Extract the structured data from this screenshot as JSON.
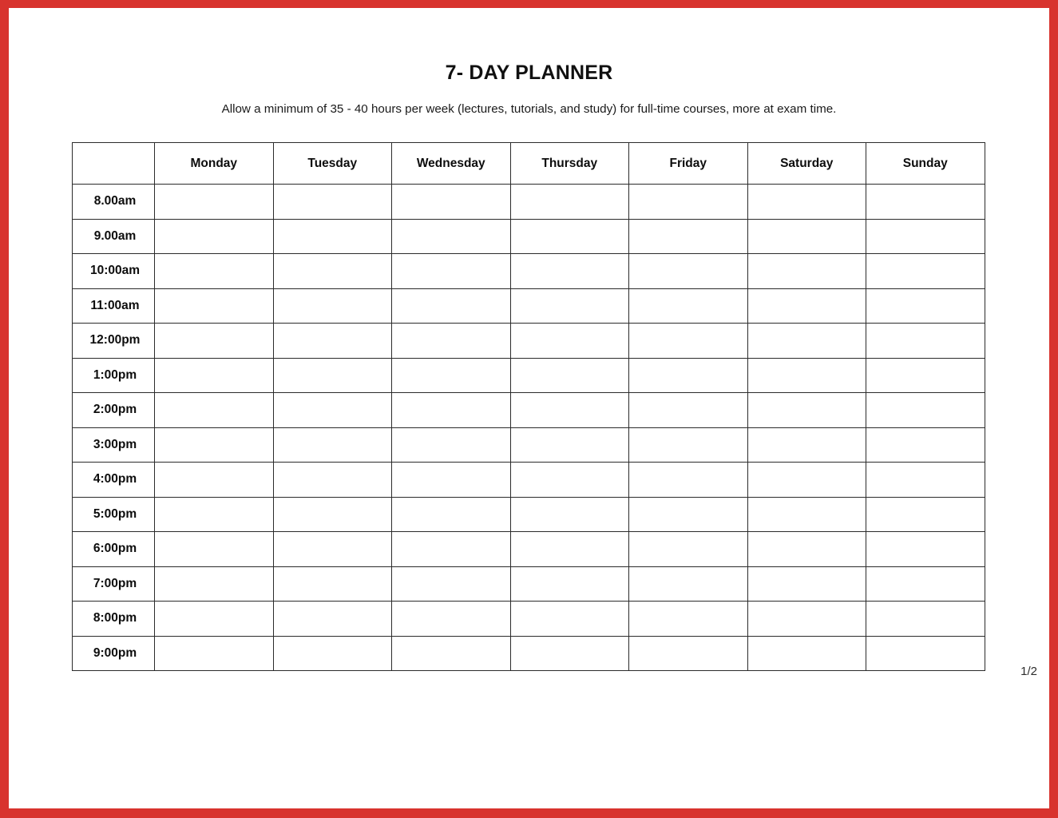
{
  "document": {
    "title": "7- DAY PLANNER",
    "subtitle": "Allow a minimum of 35 - 40 hours per week (lectures, tutorials, and study) for full-time courses, more at exam time.",
    "page_indicator": "1/2",
    "accent_color": "#d8332e",
    "border_color": "#d8332e",
    "grid_line_color": "#2b2b2b",
    "background_color": "#ffffff",
    "text_color": "#0d0d0d"
  },
  "table": {
    "corner_header": "",
    "day_headers": [
      "Monday",
      "Tuesday",
      "Wednesday",
      "Thursday",
      "Friday",
      "Saturday",
      "Sunday"
    ],
    "time_labels": [
      "8.00am",
      "9.00am",
      "10:00am",
      "11:00am",
      "12:00pm",
      "1:00pm",
      "2:00pm",
      "3:00pm",
      "4:00pm",
      "5:00pm",
      "6:00pm",
      "7:00pm",
      "8:00pm",
      "9:00pm"
    ],
    "cells": [
      [
        "",
        "",
        "",
        "",
        "",
        "",
        ""
      ],
      [
        "",
        "",
        "",
        "",
        "",
        "",
        ""
      ],
      [
        "",
        "",
        "",
        "",
        "",
        "",
        ""
      ],
      [
        "",
        "",
        "",
        "",
        "",
        "",
        ""
      ],
      [
        "",
        "",
        "",
        "",
        "",
        "",
        ""
      ],
      [
        "",
        "",
        "",
        "",
        "",
        "",
        ""
      ],
      [
        "",
        "",
        "",
        "",
        "",
        "",
        ""
      ],
      [
        "",
        "",
        "",
        "",
        "",
        "",
        ""
      ],
      [
        "",
        "",
        "",
        "",
        "",
        "",
        ""
      ],
      [
        "",
        "",
        "",
        "",
        "",
        "",
        ""
      ],
      [
        "",
        "",
        "",
        "",
        "",
        "",
        ""
      ],
      [
        "",
        "",
        "",
        "",
        "",
        "",
        ""
      ],
      [
        "",
        "",
        "",
        "",
        "",
        "",
        ""
      ],
      [
        "",
        "",
        "",
        "",
        "",
        "",
        ""
      ]
    ]
  }
}
